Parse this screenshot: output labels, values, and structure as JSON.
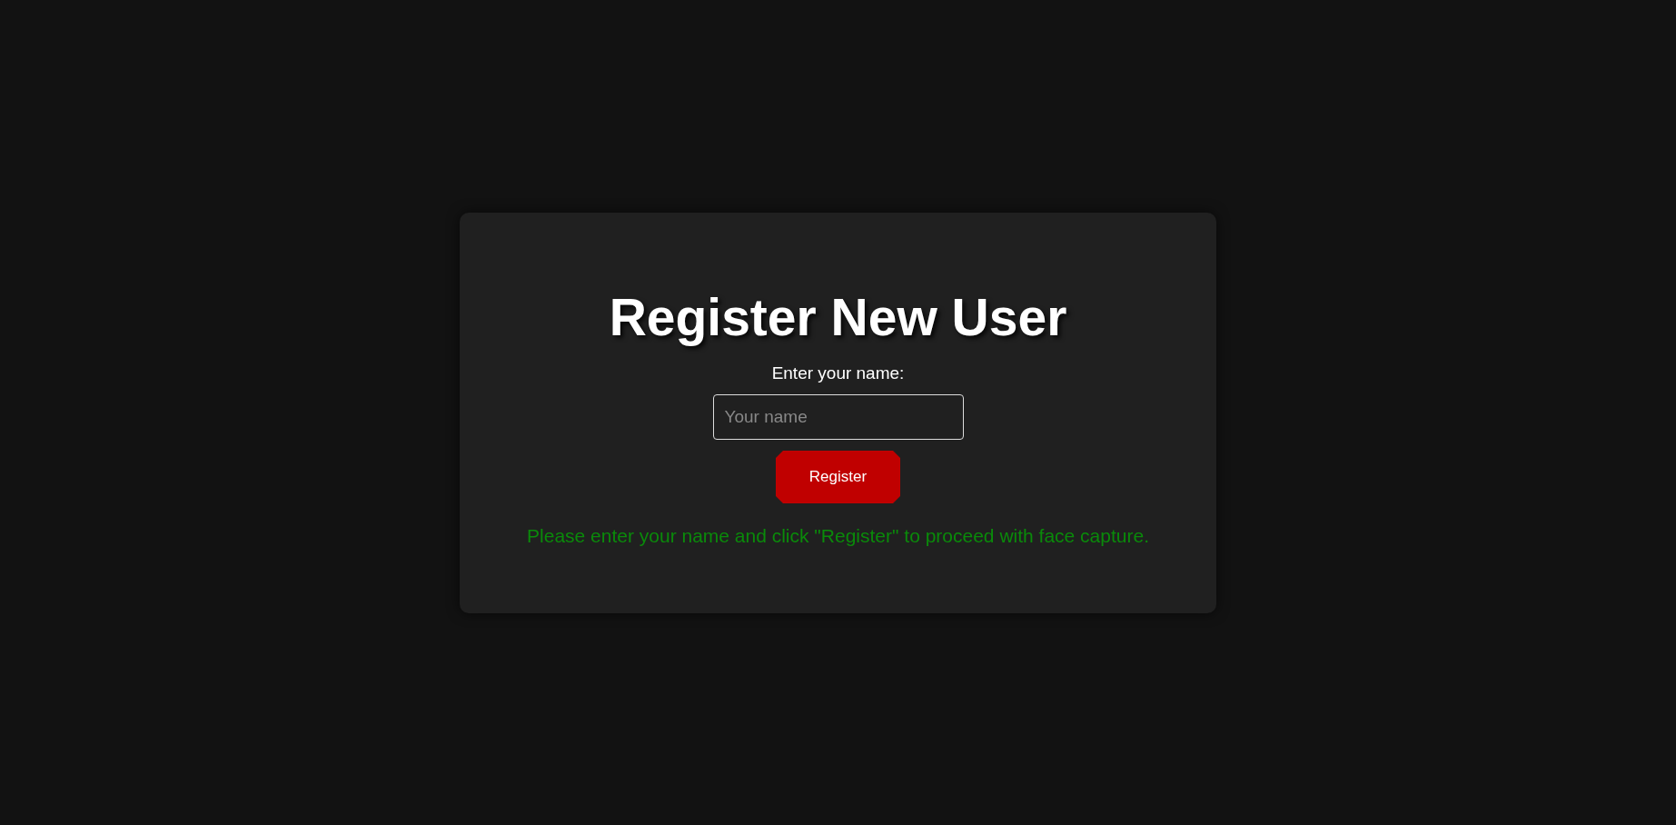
{
  "title": "Register New User",
  "name_field": {
    "label": "Enter your name:",
    "placeholder": "Your name"
  },
  "register_button": {
    "label": "Register"
  },
  "message": "Please enter your name and click \"Register\" to proceed with face capture."
}
